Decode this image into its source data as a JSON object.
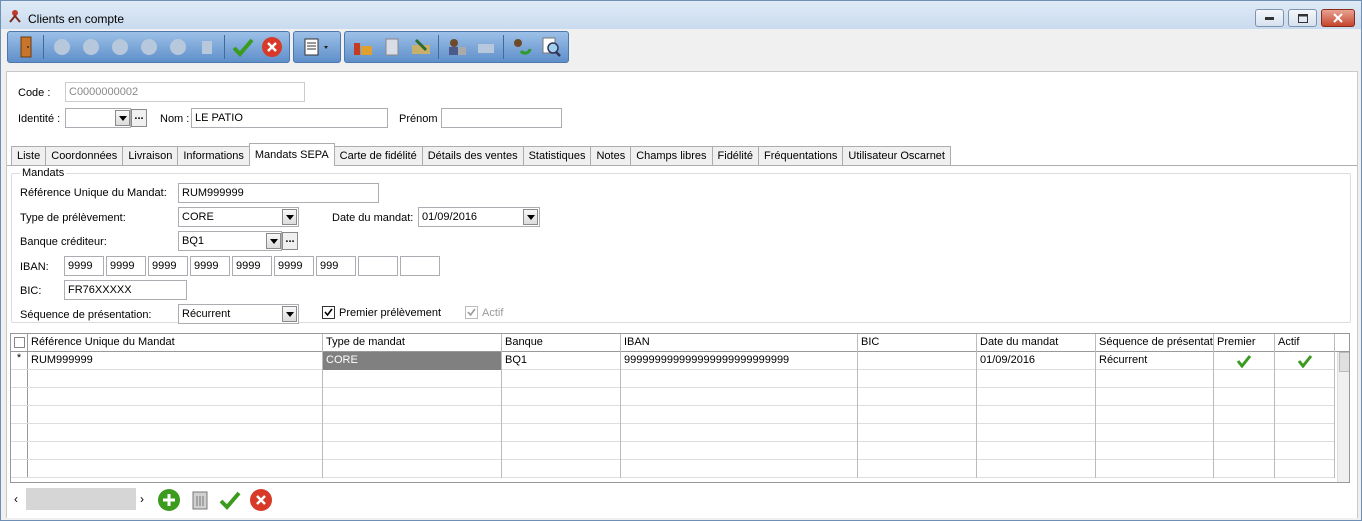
{
  "window": {
    "title": "Clients en compte"
  },
  "header": {
    "code_label": "Code :",
    "code_value": "C0000000002",
    "identite_label": "Identité :",
    "identite_value": "",
    "nom_label": "Nom :",
    "nom_value": "LE PATIO",
    "prenom_label": "Prénom :",
    "prenom_value": ""
  },
  "tabs": [
    {
      "label": "Liste"
    },
    {
      "label": "Coordonnées"
    },
    {
      "label": "Livraison"
    },
    {
      "label": "Informations"
    },
    {
      "label": "Mandats SEPA"
    },
    {
      "label": "Carte de fidélité"
    },
    {
      "label": "Détails des ventes"
    },
    {
      "label": "Statistiques"
    },
    {
      "label": "Notes"
    },
    {
      "label": "Champs libres"
    },
    {
      "label": "Fidélité"
    },
    {
      "label": "Fréquentations"
    },
    {
      "label": "Utilisateur Oscarnet"
    }
  ],
  "selected_tab": "Mandats SEPA",
  "mandats": {
    "group_title": "Mandats",
    "rum_label": "Référence Unique du Mandat:",
    "rum_value": "RUM999999",
    "type_label": "Type de prélèvement:",
    "type_value": "CORE",
    "date_label": "Date du mandat:",
    "date_value": "01/09/2016",
    "banque_label": "Banque créditeur:",
    "banque_value": "BQ1",
    "iban_label": "IBAN:",
    "iban_parts": [
      "9999",
      "9999",
      "9999",
      "9999",
      "9999",
      "9999",
      "999",
      "",
      ""
    ],
    "bic_label": "BIC:",
    "bic_value": "FR76XXXXX",
    "sequence_label": "Séquence de présentation:",
    "sequence_value": "Récurrent",
    "premier_label": "Premier prélèvement",
    "premier_checked": true,
    "actif_label": "Actif",
    "actif_checked": true
  },
  "grid": {
    "columns": [
      "Référence Unique du Mandat",
      "Type de mandat",
      "Banque",
      "IBAN",
      "BIC",
      "Date du mandat",
      "Séquence de présentati",
      "Premier",
      "Actif"
    ],
    "rows": [
      {
        "marker": "*",
        "cells": [
          "RUM999999",
          "CORE",
          "BQ1",
          "999999999999999999999999999",
          "",
          "01/09/2016",
          "Récurrent"
        ],
        "premier": true,
        "actif": true
      }
    ]
  },
  "colors": {
    "title_bg": "#c9dbee",
    "toolbar_bg": "#5f8fca",
    "check_green": "#3b9b1f",
    "cancel_red": "#d83a2a"
  }
}
